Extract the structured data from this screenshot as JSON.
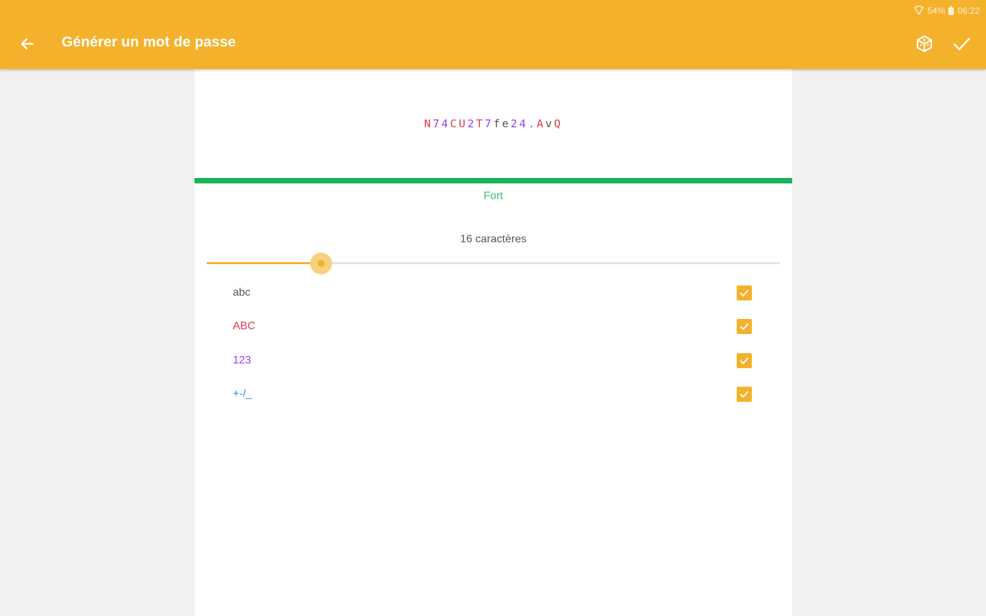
{
  "status_bar": {
    "battery": "54%",
    "time": "06:22"
  },
  "app_bar": {
    "title": "Générer un mot de passe",
    "background_color": "#f4b12b",
    "back_icon": "arrow-left-icon",
    "dice_icon": "dice-icon",
    "confirm_icon": "check-icon"
  },
  "password": {
    "chars": [
      {
        "c": "N",
        "color": "#e53950"
      },
      {
        "c": "7",
        "color": "#9b3ee8"
      },
      {
        "c": "4",
        "color": "#9b3ee8"
      },
      {
        "c": "C",
        "color": "#e53950"
      },
      {
        "c": "U",
        "color": "#e53950"
      },
      {
        "c": "2",
        "color": "#9b3ee8"
      },
      {
        "c": "T",
        "color": "#e53950"
      },
      {
        "c": "7",
        "color": "#9b3ee8"
      },
      {
        "c": "f",
        "color": "#555555"
      },
      {
        "c": "e",
        "color": "#555555"
      },
      {
        "c": "2",
        "color": "#9b3ee8"
      },
      {
        "c": "4",
        "color": "#9b3ee8"
      },
      {
        "c": ".",
        "color": "#2f8ee8"
      },
      {
        "c": "A",
        "color": "#e53950"
      },
      {
        "c": "v",
        "color": "#555555"
      },
      {
        "c": "Q",
        "color": "#e53950"
      }
    ]
  },
  "strength": {
    "label": "Fort",
    "level": 1.0,
    "color": "#19b35a"
  },
  "length": {
    "label": "16 caractères",
    "value": 16,
    "fraction": 0.2
  },
  "options": [
    {
      "label": "abc",
      "checked": true,
      "color": "#555555"
    },
    {
      "label": "ABC",
      "checked": true,
      "color": "#e53950"
    },
    {
      "label": "123",
      "checked": true,
      "color": "#9b3ee8"
    },
    {
      "label": "+-/_",
      "checked": true,
      "color": "#2f8ee8"
    }
  ]
}
